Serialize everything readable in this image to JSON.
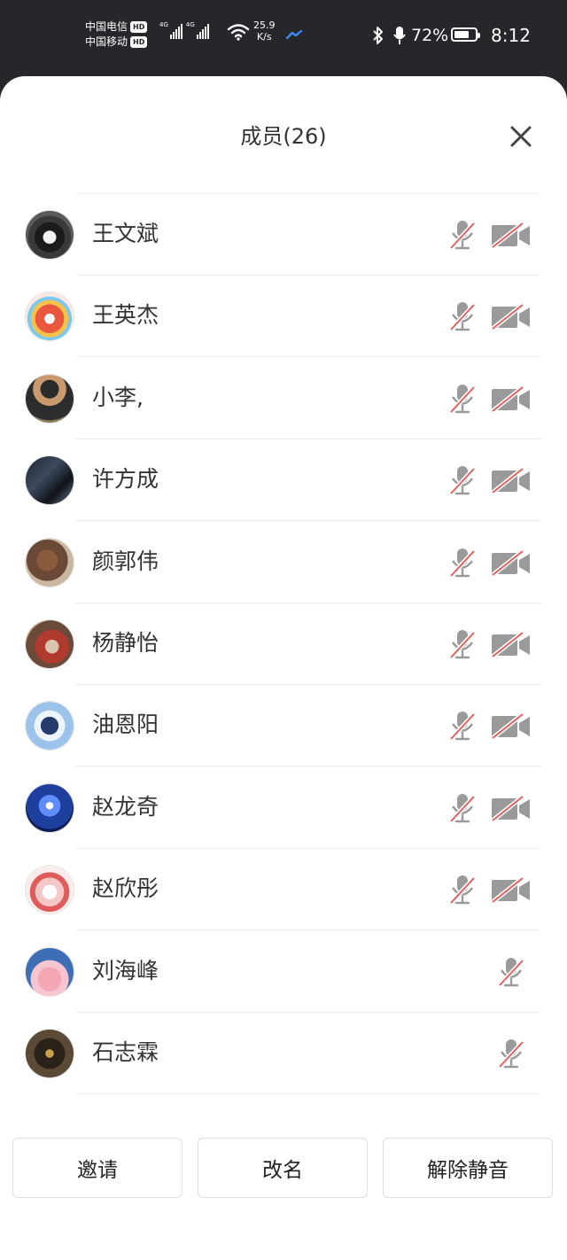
{
  "status_bar": {
    "carrier1": "中国电信",
    "carrier2": "中国移动",
    "hd": "HD",
    "net1": "4G",
    "net2": "4G",
    "speed_value": "25.9",
    "speed_unit": "K/s",
    "battery_percent": "72%",
    "battery_level": 0.72,
    "time": "8:12"
  },
  "sheet": {
    "title": "成员(26)",
    "members": [
      {
        "name": "王文斌",
        "mic_muted": true,
        "camera_off": true
      },
      {
        "name": "王英杰",
        "mic_muted": true,
        "camera_off": true
      },
      {
        "name": "小李,",
        "mic_muted": true,
        "camera_off": true
      },
      {
        "name": "许方成",
        "mic_muted": true,
        "camera_off": true
      },
      {
        "name": "颜郭伟",
        "mic_muted": true,
        "camera_off": true
      },
      {
        "name": "杨静怡",
        "mic_muted": true,
        "camera_off": true
      },
      {
        "name": "油恩阳",
        "mic_muted": true,
        "camera_off": true
      },
      {
        "name": "赵龙奇",
        "mic_muted": true,
        "camera_off": true
      },
      {
        "name": "赵欣彤",
        "mic_muted": true,
        "camera_off": true
      },
      {
        "name": "刘海峰",
        "mic_muted": true
      },
      {
        "name": "石志霖",
        "mic_muted": true
      }
    ]
  },
  "footer": {
    "invite_label": "邀请",
    "rename_label": "改名",
    "unmute_label": "解除静音"
  },
  "colors": {
    "mute_slash": "#e06060",
    "icon_gray": "#9a9a9a",
    "status_bg": "#25272b"
  }
}
